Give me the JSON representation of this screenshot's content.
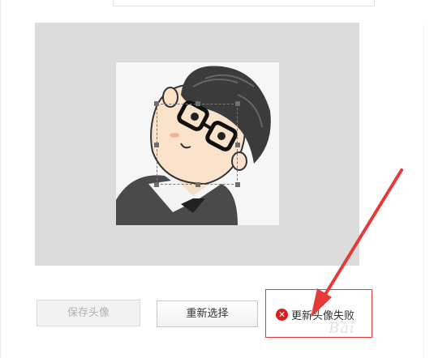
{
  "crop": {
    "avatar_label": "cartoon-avatar-image"
  },
  "buttons": {
    "save_label": "保存头像",
    "reselect_label": "重新选择"
  },
  "status": {
    "icon": "error-x-icon",
    "message": "更新头像失败"
  },
  "watermark": {
    "text": "Bai"
  },
  "colors": {
    "error_red": "#e73b3b",
    "arrow_red": "#e5393b"
  }
}
